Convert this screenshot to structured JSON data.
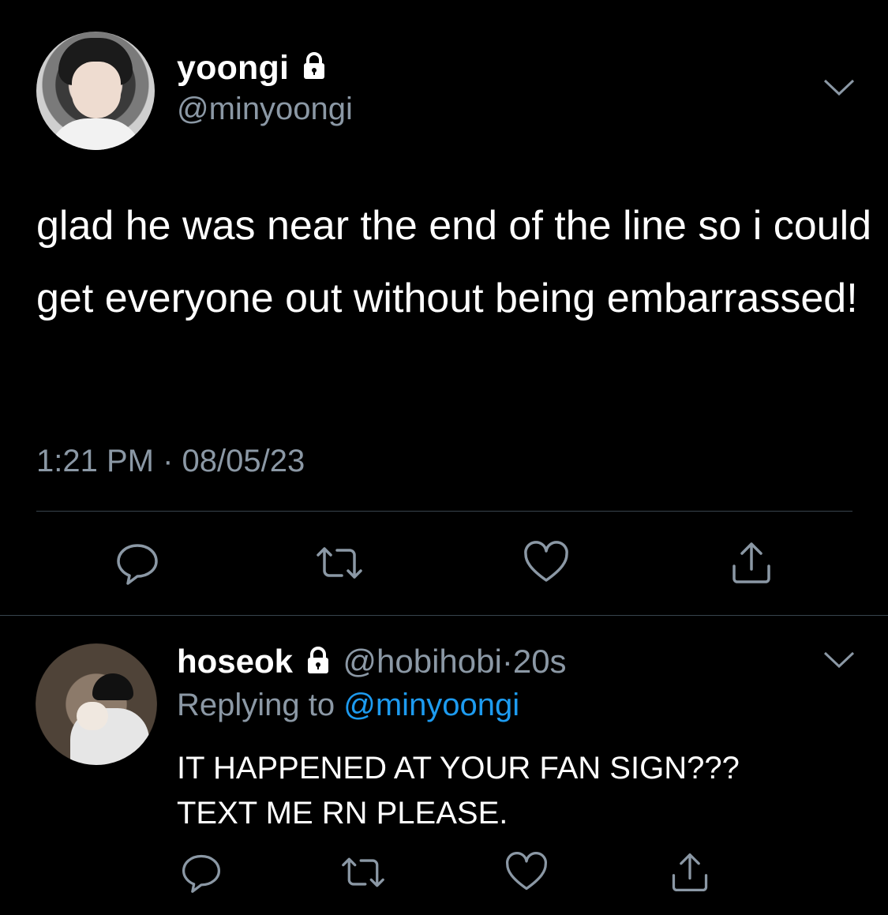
{
  "tweet": {
    "author_name": "yoongi",
    "author_handle": "@minyoongi",
    "text": "glad he was near the end of the line so i could get everyone out without being embarrassed!",
    "time": "1:21 PM",
    "separator": "·",
    "date": "08/05/23"
  },
  "reply": {
    "author_name": "hoseok",
    "author_handle": "@hobihobi",
    "separator": "·",
    "age": "20s",
    "replying_label": "Replying to",
    "replying_handle": "@minyoongi",
    "text_line1": "IT HAPPENED AT YOUR FAN SIGN???",
    "text_line2": "TEXT ME RN PLEASE."
  },
  "icons": [
    "lock-icon",
    "chevron-down-icon",
    "reply-icon",
    "retweet-icon",
    "like-icon",
    "share-icon"
  ],
  "colors": {
    "background": "#000000",
    "text": "#ffffff",
    "secondary": "#8b98a5",
    "link": "#1d9bf0",
    "divider": "#38444d"
  }
}
